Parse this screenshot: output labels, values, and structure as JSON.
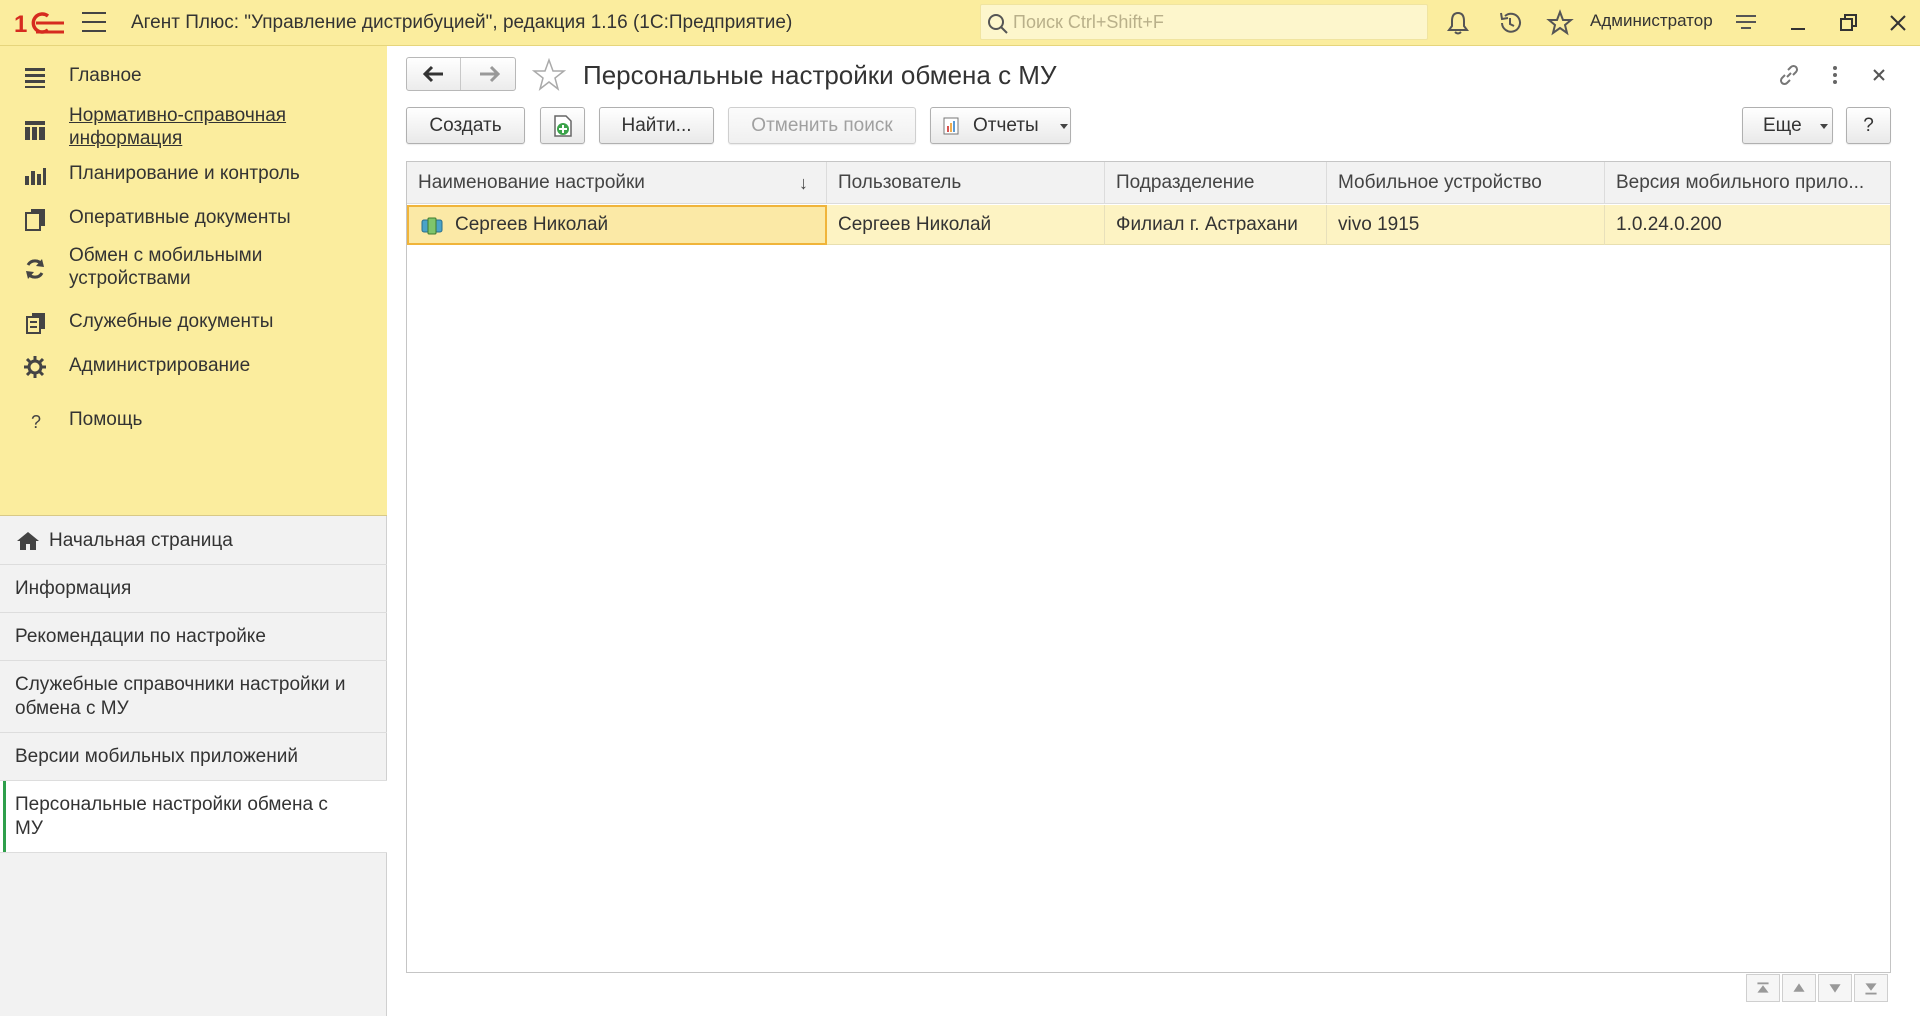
{
  "titlebar": {
    "app_title": "Агент Плюс: \"Управление дистрибуцией\", редакция 1.16  (1С:Предприятие)",
    "search_placeholder": "Поиск Ctrl+Shift+F",
    "user": "Администратор",
    "accent": "#fbed9e"
  },
  "sidebar": {
    "sections": [
      {
        "label": "Главное",
        "icon": "list-icon"
      },
      {
        "label": "Нормативно-справочная информация",
        "icon": "catalog-icon"
      },
      {
        "label": "Планирование и контроль",
        "icon": "chart-icon"
      },
      {
        "label": "Оперативные документы",
        "icon": "documents-icon"
      },
      {
        "label": "Обмен с мобильными устройствами",
        "icon": "sync-icon"
      },
      {
        "label": "Служебные документы",
        "icon": "service-docs-icon"
      },
      {
        "label": "Администрирование",
        "icon": "gear-icon"
      },
      {
        "label": "Помощь",
        "icon": "question-icon"
      }
    ],
    "nav": [
      {
        "label": "Начальная страница"
      },
      {
        "label": "Информация"
      },
      {
        "label": "Рекомендации по настройке"
      },
      {
        "label": "Служебные справочники настройки и обмена с МУ"
      },
      {
        "label": "Версии мобильных приложений"
      },
      {
        "label": "Персональные настройки обмена с МУ"
      }
    ]
  },
  "main": {
    "title": "Персональные настройки обмена с МУ",
    "toolbar": {
      "create": "Создать",
      "find": "Найти...",
      "cancel_search": "Отменить поиск",
      "reports": "Отчеты",
      "more": "Еще",
      "help": "?"
    },
    "table": {
      "columns": [
        "Наименование настройки",
        "Пользователь",
        "Подразделение",
        "Мобильное устройство",
        "Версия мобильного прило..."
      ],
      "sort_indicator": "↓",
      "rows": [
        [
          "Сергеев Николай",
          "Сергеев Николай",
          "Филиал г. Астрахани",
          "vivo 1915",
          "1.0.24.0.200"
        ]
      ]
    }
  }
}
